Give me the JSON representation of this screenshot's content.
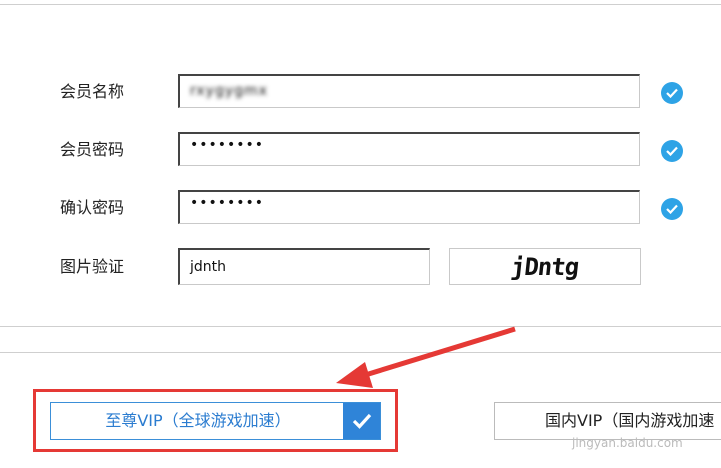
{
  "form": {
    "fields": [
      {
        "label": "会员名称",
        "value": "rxygygmx"
      },
      {
        "label": "会员密码",
        "value": "••••••••"
      },
      {
        "label": "确认密码",
        "value": "••••••••"
      },
      {
        "label": "图片验证",
        "value": "jdnth"
      }
    ],
    "captcha_text": "jDntg"
  },
  "buttons": {
    "premium_vip_label": "至尊VIP（全球游戏加速）",
    "domestic_vip_label": "国内VIP（国内游戏加速"
  },
  "watermark": "jingyan.baidu.com",
  "colors": {
    "check_blue": "#2ea3e6",
    "button_blue": "#2f84d8",
    "highlight_red": "#e53935"
  },
  "icons": [
    "check-circle-icon",
    "checkmark-icon",
    "red-arrow-annotation"
  ]
}
